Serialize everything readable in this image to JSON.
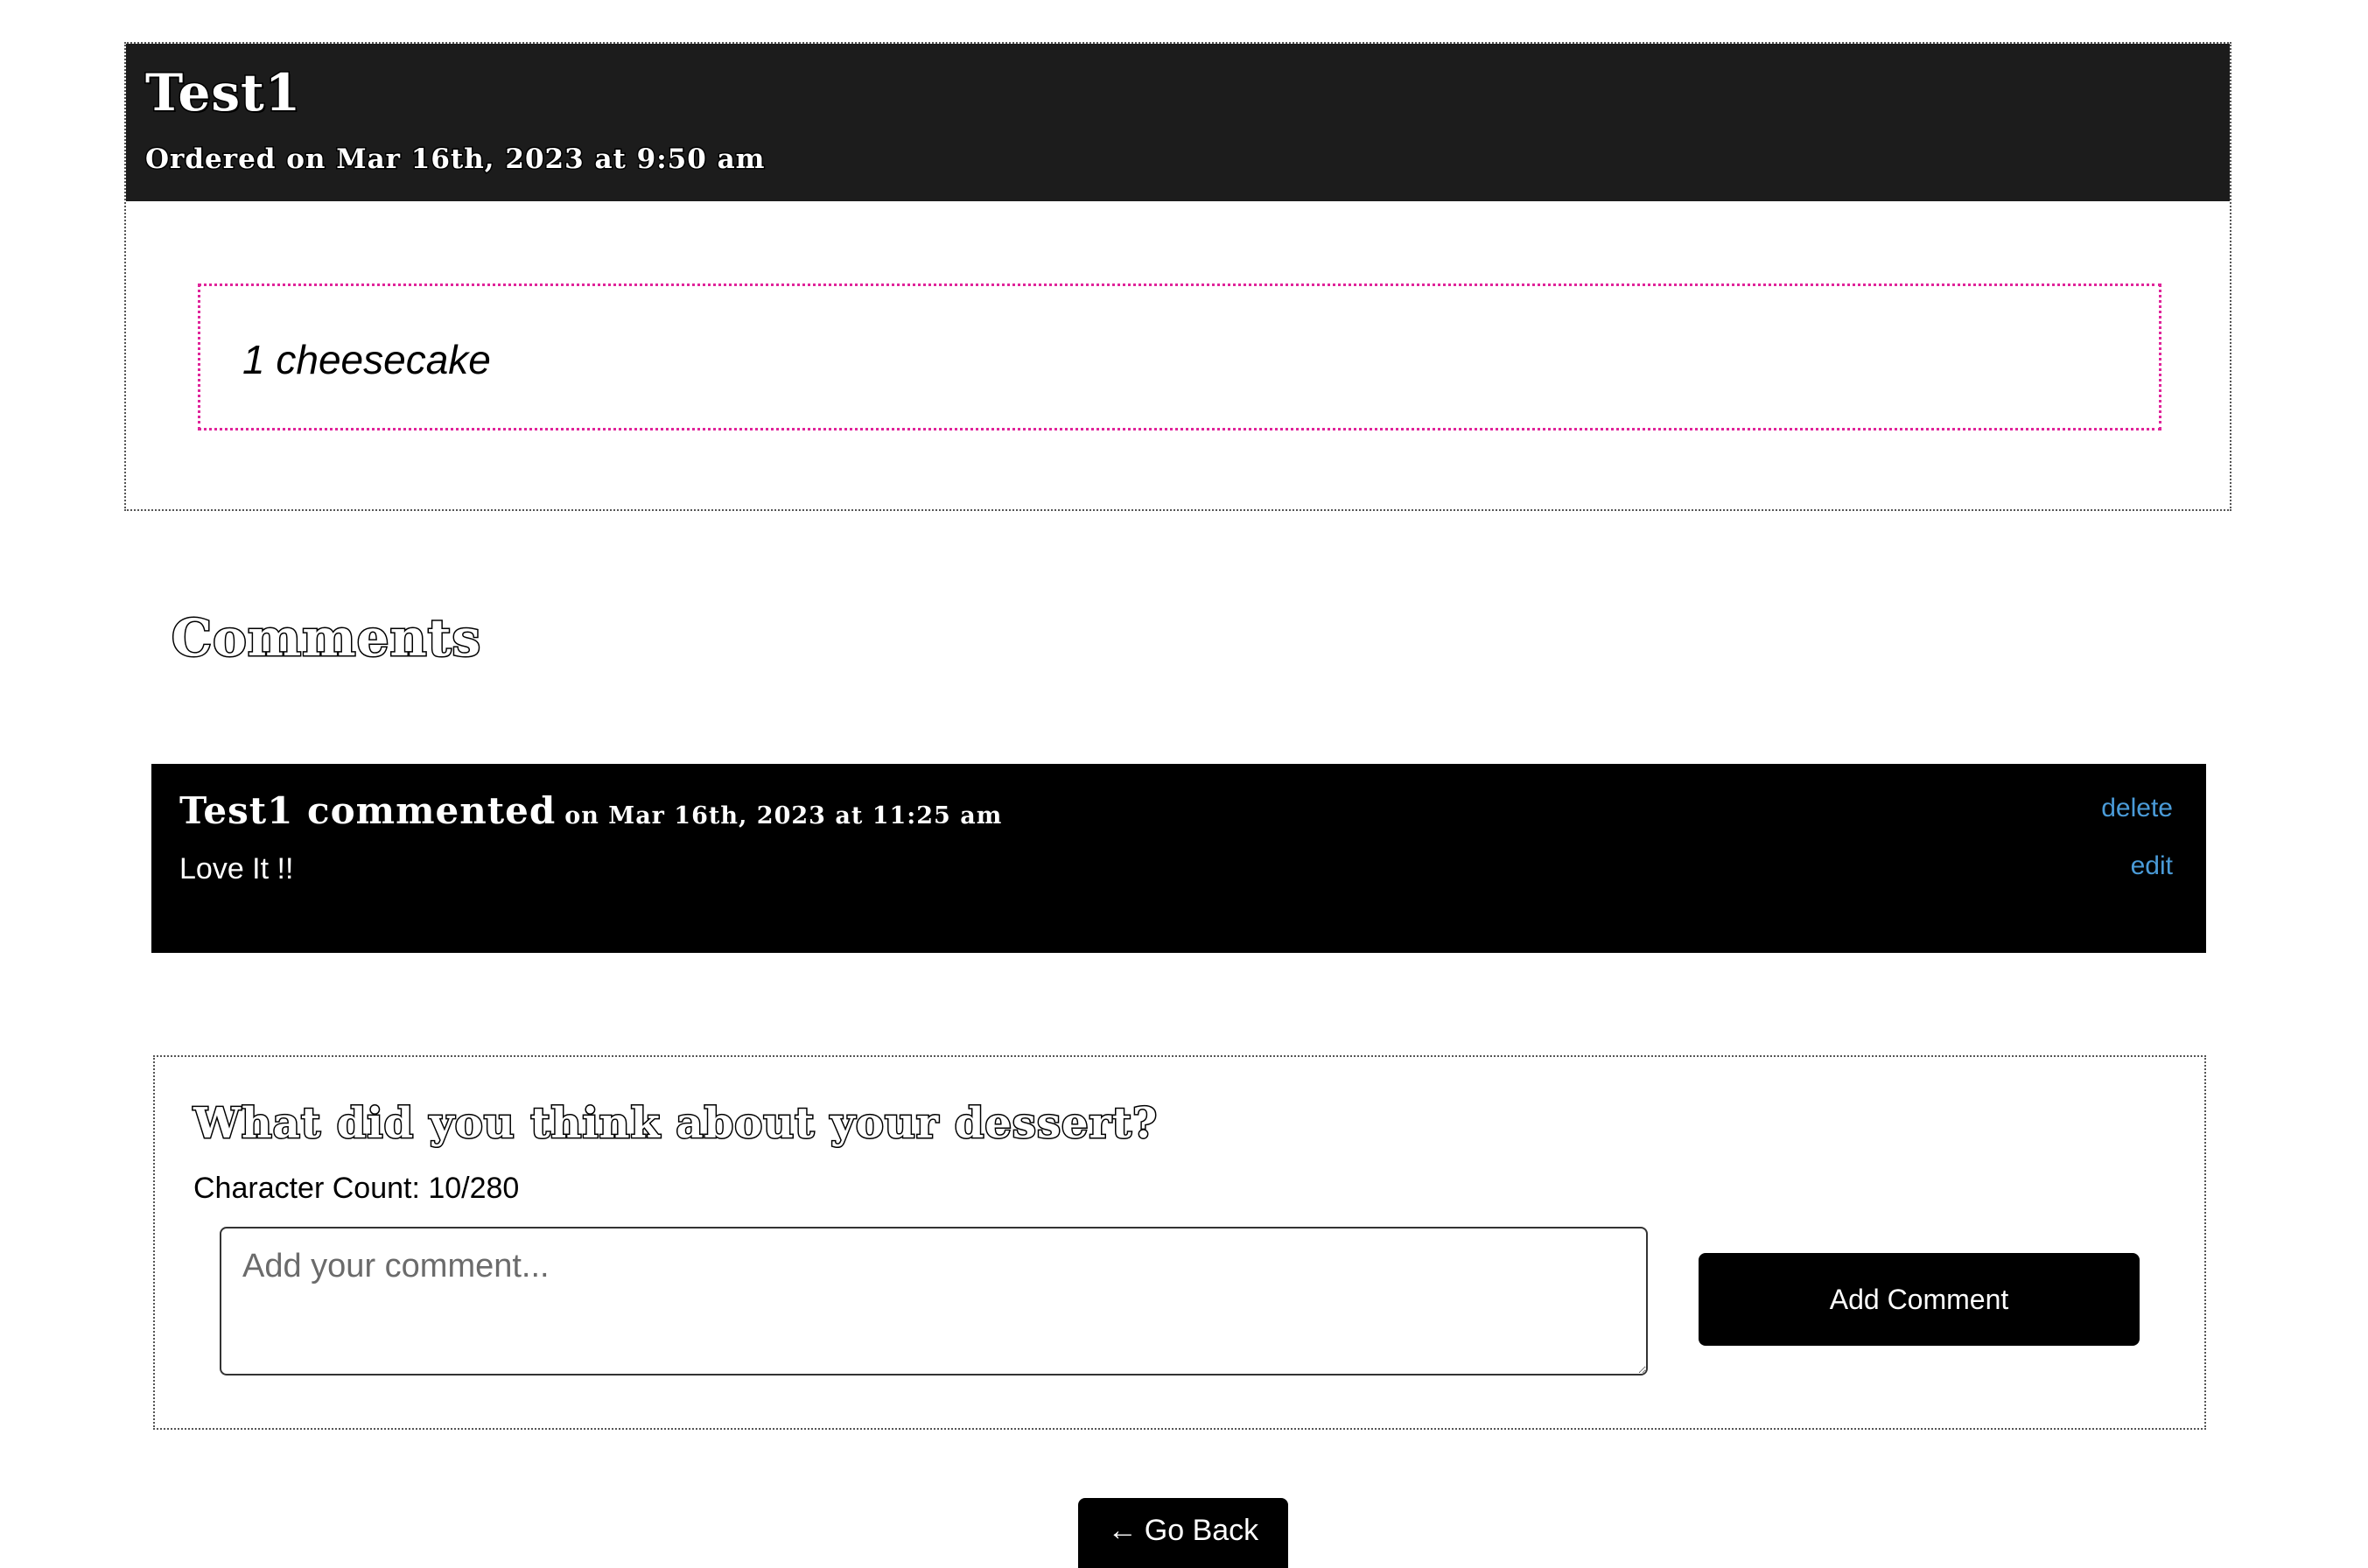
{
  "order": {
    "title": "Test1",
    "ordered_on": "Ordered on Mar 16th, 2023 at 9:50 am",
    "items": [
      "1 cheesecake"
    ]
  },
  "comments_section": {
    "heading": "Comments"
  },
  "comments": [
    {
      "author_text": "Test1 commented",
      "date_text": "on Mar 16th, 2023 at 11:25 am",
      "body": "Love It !!",
      "delete_label": "delete",
      "edit_label": "edit"
    }
  ],
  "comment_form": {
    "title": "What did you think about your dessert?",
    "char_count": "Character Count: 10/280",
    "placeholder": "Add your comment...",
    "submit_label": "Add Comment"
  },
  "nav": {
    "back_arrow": "←",
    "back_label": "Go Back"
  },
  "colors": {
    "header_bg": "#1c1c1c",
    "comment_bg": "#000000",
    "link": "#4a9bd8",
    "item_border": "#e0249a"
  }
}
